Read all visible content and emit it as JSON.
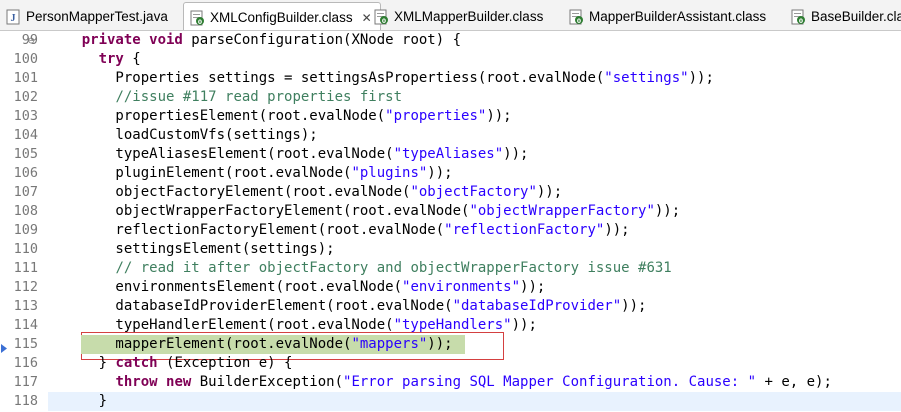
{
  "tabs": [
    {
      "label": "PersonMapperTest.java",
      "icon": "java-file-icon",
      "active": false
    },
    {
      "label": "XMLConfigBuilder.class",
      "icon": "class-file-icon",
      "active": true,
      "close": "✕"
    },
    {
      "label": "XMLMapperBuilder.class",
      "icon": "class-file-icon",
      "active": false
    },
    {
      "label": "MapperBuilderAssistant.class",
      "icon": "class-file-icon",
      "active": false
    },
    {
      "label": "BaseBuilder.class",
      "icon": "class-file-icon",
      "active": false
    }
  ],
  "code_lines": [
    {
      "num": "99",
      "fold": "⊖",
      "segments": [
        [
          "    ",
          ""
        ],
        [
          "private void",
          "kw"
        ],
        [
          " parseConfiguration(XNode root) {",
          ""
        ]
      ]
    },
    {
      "num": "100",
      "segments": [
        [
          "      ",
          ""
        ],
        [
          "try",
          "kw"
        ],
        [
          " {",
          ""
        ]
      ]
    },
    {
      "num": "101",
      "segments": [
        [
          "        Properties settings = settingsAsPropertiess(root.evalNode(",
          ""
        ],
        [
          "\"settings\"",
          "str"
        ],
        [
          "));",
          ""
        ]
      ]
    },
    {
      "num": "102",
      "segments": [
        [
          "        ",
          ""
        ],
        [
          "//issue #117 read properties first",
          "cmt"
        ]
      ]
    },
    {
      "num": "103",
      "segments": [
        [
          "        propertiesElement(root.evalNode(",
          ""
        ],
        [
          "\"properties\"",
          "str"
        ],
        [
          "));",
          ""
        ]
      ]
    },
    {
      "num": "104",
      "segments": [
        [
          "        loadCustomVfs(settings);",
          ""
        ]
      ]
    },
    {
      "num": "105",
      "segments": [
        [
          "        typeAliasesElement(root.evalNode(",
          ""
        ],
        [
          "\"typeAliases\"",
          "str"
        ],
        [
          "));",
          ""
        ]
      ]
    },
    {
      "num": "106",
      "segments": [
        [
          "        pluginElement(root.evalNode(",
          ""
        ],
        [
          "\"plugins\"",
          "str"
        ],
        [
          "));",
          ""
        ]
      ]
    },
    {
      "num": "107",
      "segments": [
        [
          "        objectFactoryElement(root.evalNode(",
          ""
        ],
        [
          "\"objectFactory\"",
          "str"
        ],
        [
          "));",
          ""
        ]
      ]
    },
    {
      "num": "108",
      "segments": [
        [
          "        objectWrapperFactoryElement(root.evalNode(",
          ""
        ],
        [
          "\"objectWrapperFactory\"",
          "str"
        ],
        [
          "));",
          ""
        ]
      ]
    },
    {
      "num": "109",
      "segments": [
        [
          "        reflectionFactoryElement(root.evalNode(",
          ""
        ],
        [
          "\"reflectionFactory\"",
          "str"
        ],
        [
          "));",
          ""
        ]
      ]
    },
    {
      "num": "110",
      "segments": [
        [
          "        settingsElement(settings);",
          ""
        ]
      ]
    },
    {
      "num": "111",
      "segments": [
        [
          "        ",
          ""
        ],
        [
          "// read it after objectFactory and objectWrapperFactory issue #631",
          "cmt"
        ]
      ]
    },
    {
      "num": "112",
      "segments": [
        [
          "        environmentsElement(root.evalNode(",
          ""
        ],
        [
          "\"environments\"",
          "str"
        ],
        [
          "));",
          ""
        ]
      ]
    },
    {
      "num": "113",
      "segments": [
        [
          "        databaseIdProviderElement(root.evalNode(",
          ""
        ],
        [
          "\"databaseIdProvider\"",
          "str"
        ],
        [
          "));",
          ""
        ]
      ]
    },
    {
      "num": "114",
      "segments": [
        [
          "        typeHandlerElement(root.evalNode(",
          ""
        ],
        [
          "\"typeHandlers\"",
          "str"
        ],
        [
          "));",
          ""
        ]
      ]
    },
    {
      "num": "115",
      "breakpoint": true,
      "selected": true,
      "segments": [
        [
          "        mapperElement(root.evalNode(",
          ""
        ],
        [
          "\"mappers\"",
          "str"
        ],
        [
          "));",
          ""
        ]
      ]
    },
    {
      "num": "116",
      "segments": [
        [
          "      } ",
          ""
        ],
        [
          "catch",
          "kw"
        ],
        [
          " (Exception e) {",
          ""
        ]
      ]
    },
    {
      "num": "117",
      "segments": [
        [
          "        ",
          ""
        ],
        [
          "throw new",
          "kw"
        ],
        [
          " BuilderException(",
          ""
        ],
        [
          "\"Error parsing SQL Mapper Configuration. Cause: \"",
          "str"
        ],
        [
          " + e, e);",
          ""
        ]
      ]
    },
    {
      "num": "118",
      "current": true,
      "segments": [
        [
          "      }",
          ""
        ]
      ]
    }
  ]
}
